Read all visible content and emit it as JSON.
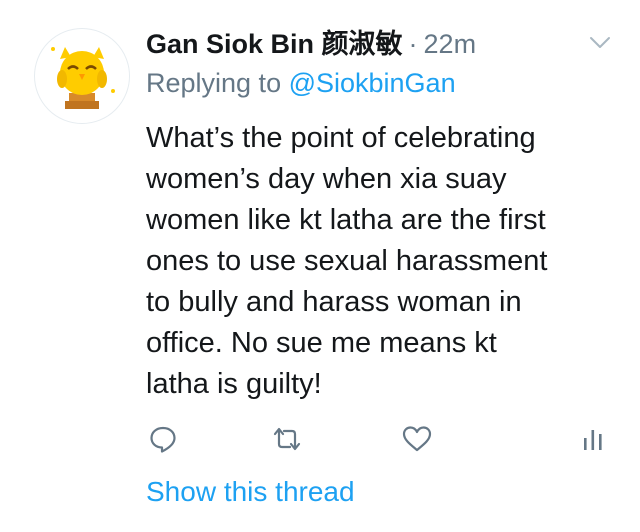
{
  "tweet": {
    "author_name": "Gan Siok Bin 颜淑敏",
    "separator": "·",
    "time": "22m",
    "replying_prefix": "Replying to ",
    "replying_handle": "@SiokbinGan",
    "text_lines": [
      "What’s the point of celebrating",
      "women’s day when xia suay",
      "women like kt latha are the first",
      "ones to use sexual harassment",
      "to bully and harass woman in",
      "office. No sue me means kt",
      "latha is guilty!"
    ],
    "show_thread": "Show this thread"
  },
  "actions": [
    {
      "name": "reply",
      "icon": "reply-icon"
    },
    {
      "name": "retweet",
      "icon": "retweet-icon"
    },
    {
      "name": "like",
      "icon": "heart-icon"
    },
    {
      "name": "analytics",
      "icon": "analytics-icon"
    }
  ],
  "colors": {
    "text": "#14171a",
    "secondary": "#657786",
    "link": "#1da1f2",
    "icon": "#657786"
  }
}
